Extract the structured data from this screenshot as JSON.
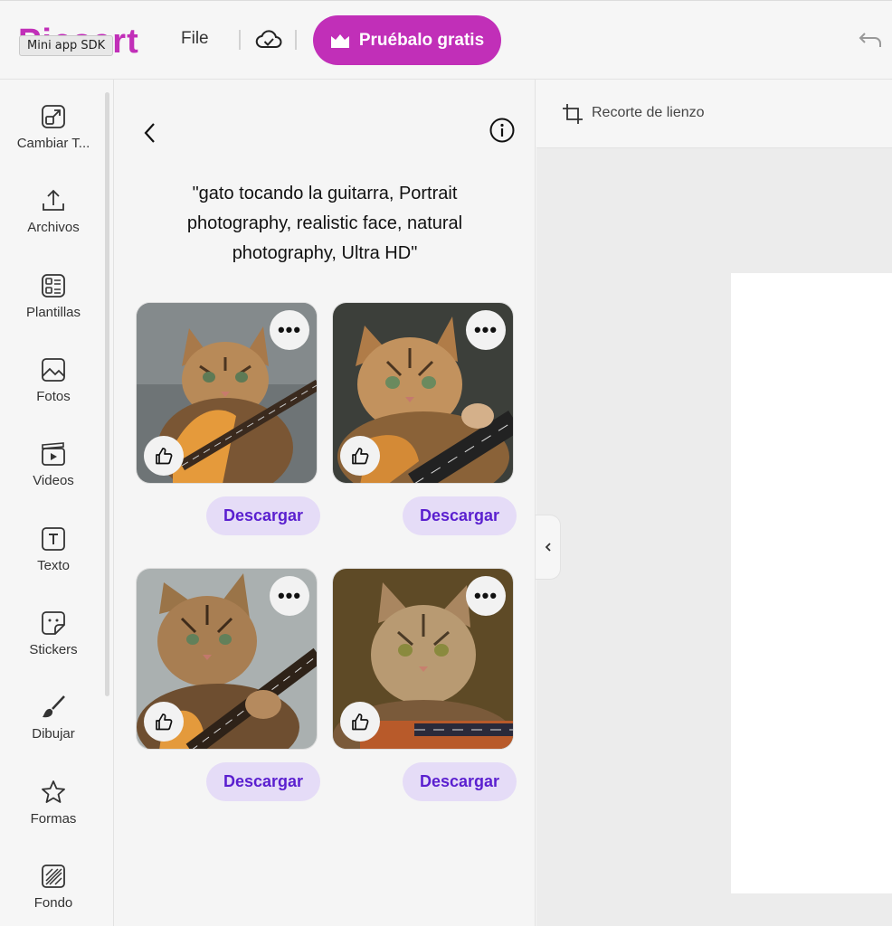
{
  "topbar": {
    "logo_text": "Picsart",
    "tooltip": "Mini app SDK",
    "file_menu": "File",
    "try_button": "Pruébalo gratis",
    "icons": [
      "cloud-check-icon",
      "crown-icon",
      "undo-icon"
    ]
  },
  "sidebar": {
    "items": [
      {
        "label": "Cambiar T...",
        "icon": "resize-icon"
      },
      {
        "label": "Archivos",
        "icon": "upload-icon"
      },
      {
        "label": "Plantillas",
        "icon": "templates-icon"
      },
      {
        "label": "Fotos",
        "icon": "photo-icon"
      },
      {
        "label": "Videos",
        "icon": "video-icon"
      },
      {
        "label": "Texto",
        "icon": "text-icon"
      },
      {
        "label": "Stickers",
        "icon": "sticker-icon"
      },
      {
        "label": "Dibujar",
        "icon": "brush-icon"
      },
      {
        "label": "Formas",
        "icon": "star-icon"
      },
      {
        "label": "Fondo",
        "icon": "background-icon"
      }
    ]
  },
  "panel": {
    "prompt": "\"gato tocando la guitarra, Portrait photography, realistic face, natural photography, Ultra HD\"",
    "more_label": "•••",
    "results": [
      {
        "download_label": "Descargar",
        "image": "cat-playing-guitar-1"
      },
      {
        "download_label": "Descargar",
        "image": "cat-playing-guitar-2"
      },
      {
        "download_label": "Descargar",
        "image": "cat-playing-guitar-3"
      },
      {
        "download_label": "Descargar",
        "image": "cat-playing-guitar-4"
      }
    ]
  },
  "canvas": {
    "crop_label": "Recorte de lienzo"
  },
  "colors": {
    "brand": "#c12fb8",
    "download_bg": "#e5dcf7",
    "download_text": "#5a1fcf"
  }
}
